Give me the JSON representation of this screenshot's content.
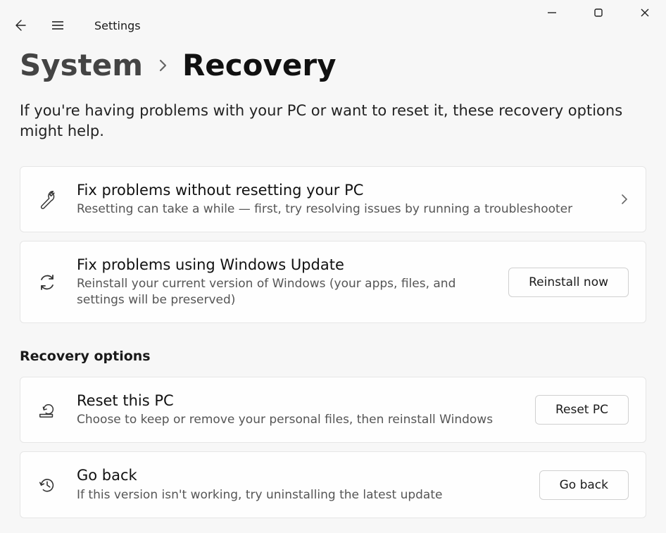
{
  "window": {
    "title": "Settings"
  },
  "breadcrumb": {
    "parent": "System",
    "current": "Recovery"
  },
  "intro": "If you're having problems with your PC or want to reset it, these recovery options might help.",
  "cards": {
    "troubleshoot": {
      "title": "Fix problems without resetting your PC",
      "desc": "Resetting can take a while — first, try resolving issues by running a troubleshooter"
    },
    "winupdate": {
      "title": "Fix problems using Windows Update",
      "desc": "Reinstall your current version of Windows (your apps, files, and settings will be preserved)",
      "button": "Reinstall now"
    }
  },
  "section_title": "Recovery options",
  "options": {
    "reset": {
      "title": "Reset this PC",
      "desc": "Choose to keep or remove your personal files, then reinstall Windows",
      "button": "Reset PC"
    },
    "goback": {
      "title": "Go back",
      "desc": "If this version isn't working, try uninstalling the latest update",
      "button": "Go back"
    }
  }
}
